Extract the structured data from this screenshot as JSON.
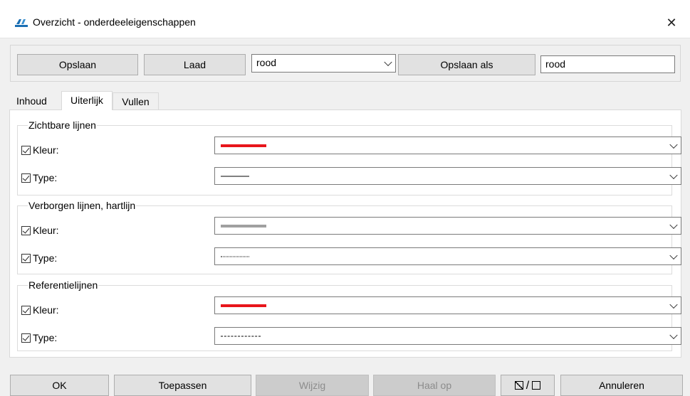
{
  "window": {
    "title": "Overzicht - onderdeeleigenschappen",
    "close_glyph": "✕"
  },
  "toolbar": {
    "save_label": "Opslaan",
    "load_label": "Laad",
    "preset_select_value": "rood",
    "save_as_label": "Opslaan als",
    "save_as_name_value": "rood"
  },
  "tabs": [
    {
      "label": "Inhoud",
      "active": false
    },
    {
      "label": "Uiterlijk",
      "active": true
    },
    {
      "label": "Vullen",
      "active": false
    }
  ],
  "groups": [
    {
      "title": "Zichtbare lijnen",
      "kleur_label": "Kleur:",
      "type_label": "Type:",
      "kleur_checked": true,
      "type_checked": true,
      "color": "#e8161b",
      "line_style": "solid"
    },
    {
      "title": "Verborgen lijnen, hartlijn",
      "kleur_label": "Kleur:",
      "type_label": "Type:",
      "kleur_checked": true,
      "type_checked": true,
      "color": "#a0a0a0",
      "line_style": "dotted"
    },
    {
      "title": "Referentielijnen",
      "kleur_label": "Kleur:",
      "type_label": "Type:",
      "kleur_checked": true,
      "type_checked": true,
      "color": "#e8161b",
      "line_style": "dashed"
    }
  ],
  "footer": {
    "ok_label": "OK",
    "apply_label": "Toepassen",
    "modify_label": "Wijzig",
    "fetch_label": "Haal op",
    "toggle_separator": "/",
    "cancel_label": "Annuleren"
  }
}
